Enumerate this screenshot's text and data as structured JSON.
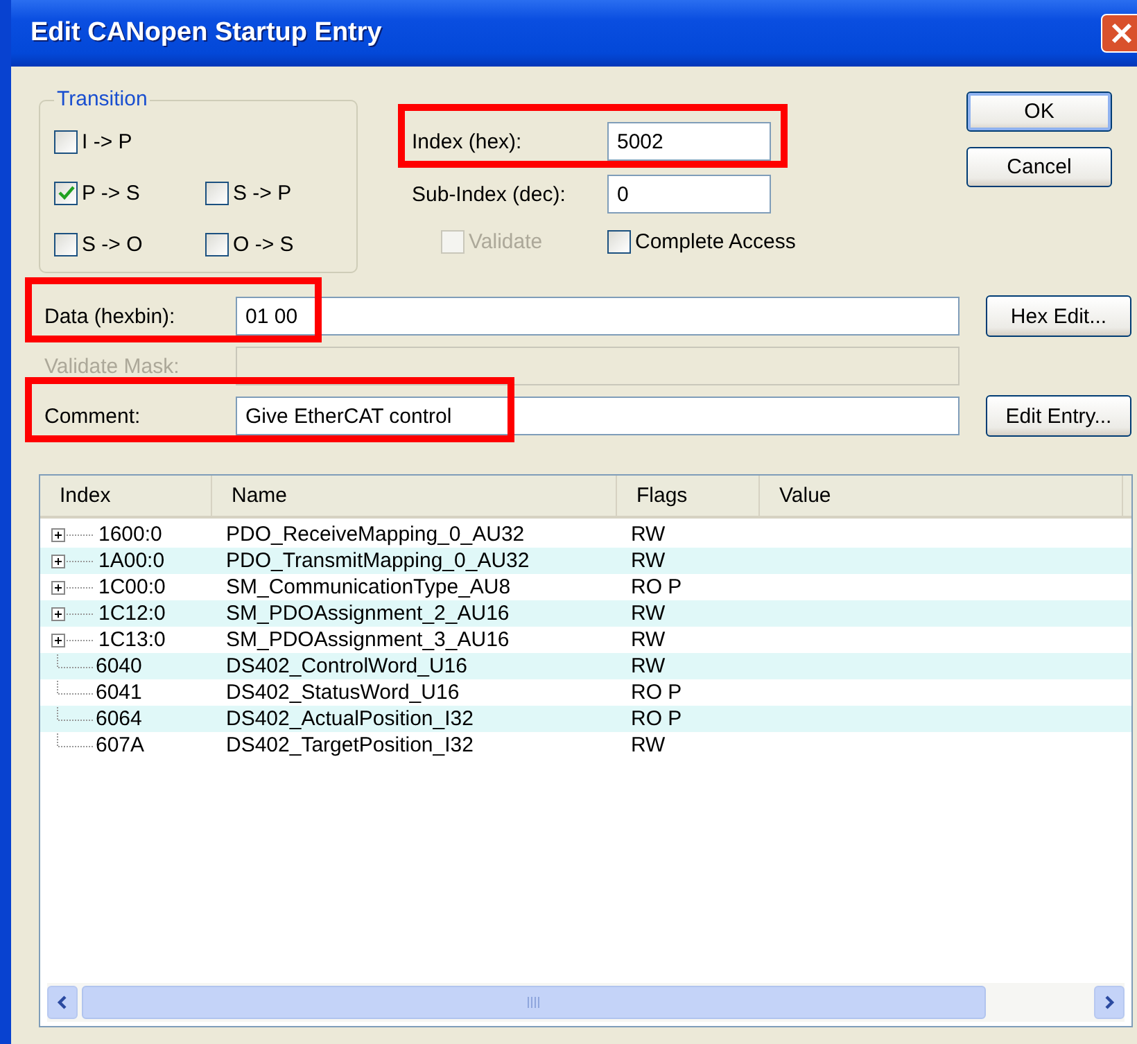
{
  "window": {
    "title": "Edit CANopen Startup Entry"
  },
  "transition": {
    "title": "Transition",
    "rows": [
      [
        {
          "label": "I -> P",
          "checked": false
        }
      ],
      [
        {
          "label": "P -> S",
          "checked": true
        },
        {
          "label": "S -> P",
          "checked": false
        }
      ],
      [
        {
          "label": "S -> O",
          "checked": false
        },
        {
          "label": "O -> S",
          "checked": false
        }
      ]
    ]
  },
  "index_fields": [
    {
      "label": "Index (hex):",
      "value": "5002",
      "highlighted": true
    },
    {
      "label": "Sub-Index (dec):",
      "value": "0",
      "highlighted": false
    }
  ],
  "options": [
    {
      "label": "Validate",
      "checked": false,
      "disabled": true
    },
    {
      "label": "Complete Access",
      "checked": false,
      "disabled": false
    }
  ],
  "dialog_buttons": [
    "OK",
    "Cancel"
  ],
  "fields": [
    {
      "label": "Data (hexbin):",
      "value": "01 00",
      "highlighted": true,
      "disabled": false,
      "button": "Hex Edit..."
    },
    {
      "label": "Validate Mask:",
      "highlighted": false,
      "disabled": true
    },
    {
      "label": "Comment:",
      "value": "Give EtherCAT control",
      "highlighted": true,
      "disabled": false,
      "button": "Edit Entry..."
    }
  ],
  "table": {
    "columns": [
      "Index",
      "Name",
      "Flags",
      "Value"
    ],
    "rows": [
      {
        "index": "1600:0",
        "name": "PDO_ReceiveMapping_0_AU32",
        "flags": "RW",
        "expandable": true
      },
      {
        "index": "1A00:0",
        "name": "PDO_TransmitMapping_0_AU32",
        "flags": "RW",
        "expandable": true
      },
      {
        "index": "1C00:0",
        "name": "SM_CommunicationType_AU8",
        "flags": "RO P",
        "expandable": true
      },
      {
        "index": "1C12:0",
        "name": "SM_PDOAssignment_2_AU16",
        "flags": "RW",
        "expandable": true
      },
      {
        "index": "1C13:0",
        "name": "SM_PDOAssignment_3_AU16",
        "flags": "RW",
        "expandable": true
      },
      {
        "index": "6040",
        "name": "DS402_ControlWord_U16",
        "flags": "RW",
        "expandable": false
      },
      {
        "index": "6041",
        "name": "DS402_StatusWord_U16",
        "flags": "RO P",
        "expandable": false
      },
      {
        "index": "6064",
        "name": "DS402_ActualPosition_I32",
        "flags": "RO P",
        "expandable": false
      },
      {
        "index": "607A",
        "name": "DS402_TargetPosition_I32",
        "flags": "RW",
        "expandable": false
      }
    ]
  }
}
